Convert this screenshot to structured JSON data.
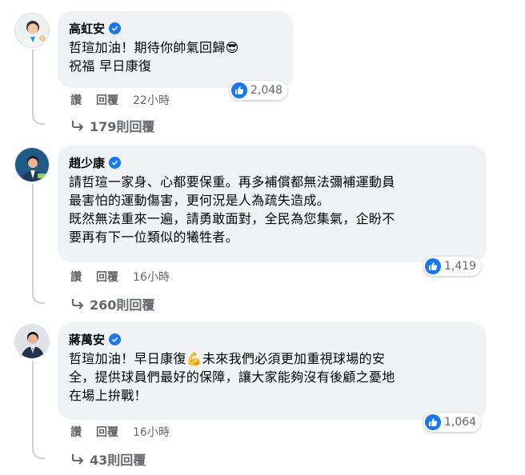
{
  "comments": [
    {
      "name": "高虹安",
      "text": "哲瑄加油！期待你帥氣回歸😎\n祝福 早日康復",
      "reactions": "2,048",
      "like_label": "讚",
      "reply_label": "回覆",
      "time": "22小時",
      "replies": "179則回覆"
    },
    {
      "name": "趙少康",
      "text": "請哲瑄一家身、心都要保重。再多補償都無法彌補運動員\n最害怕的運動傷害，更何況是人為疏失造成。\n既然無法重來一遍，請勇敢面對，全民為您集氣，企盼不\n要再有下一位類似的犧牲者。",
      "reactions": "1,419",
      "like_label": "讚",
      "reply_label": "回覆",
      "time": "16小時",
      "replies": "260則回覆"
    },
    {
      "name": "蔣萬安",
      "text": "哲瑄加油！早日康復💪未來我們必須更加重視球場的安\n全，提供球員們最好的保障，讓大家能夠沒有後顧之憂地\n在場上拚戰！",
      "reactions": "1,064",
      "like_label": "讚",
      "reply_label": "回覆",
      "time": "16小時",
      "replies": "43則回覆"
    }
  ],
  "icons": {
    "verified": "verified-check-icon",
    "like": "thumbs-up-icon",
    "reply": "reply-arrow-icon"
  },
  "colors": {
    "accent": "#1877f2",
    "bubble": "#f0f2f5",
    "muted": "#65676b"
  }
}
